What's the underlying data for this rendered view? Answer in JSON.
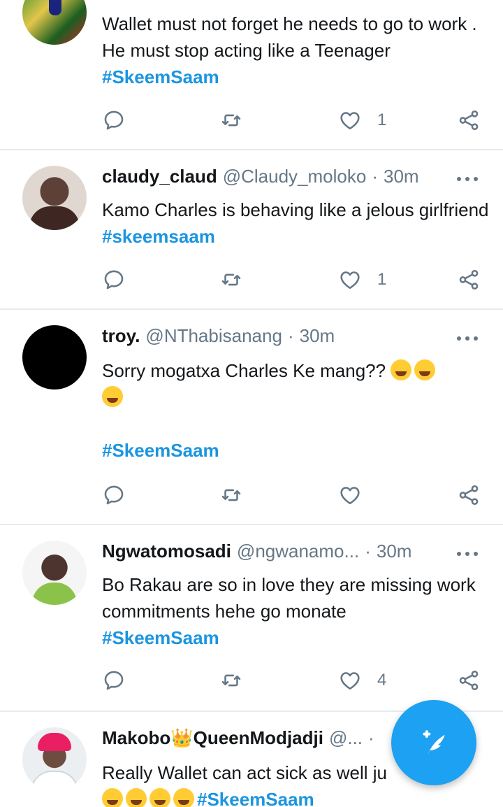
{
  "tweets": [
    {
      "text": "Wallet must not forget he needs to go to work . He must stop acting like a Teenager",
      "hashtag": "#SkeemSaam",
      "likes": "1"
    },
    {
      "name": "claudy_claud",
      "handle": "@Claudy_moloko",
      "dot": "·",
      "time": "30m",
      "text": "Kamo Charles is behaving like a jelous girlfriend",
      "hashtag": "#skeemsaam",
      "likes": "1"
    },
    {
      "name": "troy.",
      "handle": "@NThabisanang",
      "dot": "·",
      "time": "30m",
      "text": "Sorry mogatxa Charles Ke mang??",
      "emojis": [
        "rolling-on-floor-laughing",
        "tears-of-joy",
        "rolling-on-floor-laughing"
      ],
      "hashtag": "#SkeemSaam",
      "likes": ""
    },
    {
      "name": "Ngwatomosadi",
      "handle": "@ngwanamo...",
      "dot": "·",
      "time": "30m",
      "text": "Bo Rakau are so in love they are missing work commitments hehe go monate",
      "hashtag": "#SkeemSaam",
      "likes": "4"
    },
    {
      "name": "Makobo",
      "name_crown": "👑",
      "name_suffix": "QueenModjadji",
      "handle": "@...",
      "dot": "·",
      "text": "Really Wallet can act sick as well ju",
      "emojis": [
        "woozy-face",
        "rolling-on-floor-laughing",
        "rolling-on-floor-laughing",
        "tears-of-joy"
      ],
      "hashtag": "#SkeemSaam"
    }
  ],
  "icons": {
    "reply": "reply-icon",
    "retweet": "retweet-icon",
    "like": "heart-icon",
    "share": "share-icon",
    "more": "more-icon",
    "compose": "compose-tweet-icon"
  },
  "colors": {
    "accent": "#1da1f2",
    "hashtag": "#1b95e0",
    "muted": "#657786",
    "divider": "#e6ecf0"
  }
}
